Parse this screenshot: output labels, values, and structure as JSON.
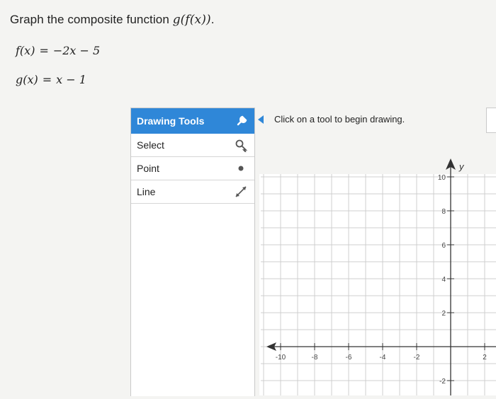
{
  "question": {
    "prefix": "Graph the composite function",
    "composite": "g(f(x))",
    "suffix": "."
  },
  "equations": [
    {
      "lhs": "f(x)",
      "eq": "=",
      "rhs": "−2x − 5"
    },
    {
      "lhs": "g(x)",
      "eq": "=",
      "rhs": "x − 1"
    }
  ],
  "tools_panel": {
    "title": "Drawing Tools",
    "header_icon": "wrench-icon",
    "items": [
      {
        "label": "Select",
        "icon": "select-pointer-icon"
      },
      {
        "label": "Point",
        "icon": "dot-icon"
      },
      {
        "label": "Line",
        "icon": "line-arrows-icon"
      }
    ]
  },
  "hint_text": "Click on a tool to begin drawing.",
  "graph": {
    "y_label": "y",
    "x_tick_labels": [
      "-10",
      "-8",
      "-6",
      "-4",
      "-2",
      "2"
    ],
    "y_tick_labels": [
      "10",
      "8",
      "6",
      "4",
      "2",
      "-2"
    ],
    "accent_color": "#2f87d8"
  }
}
